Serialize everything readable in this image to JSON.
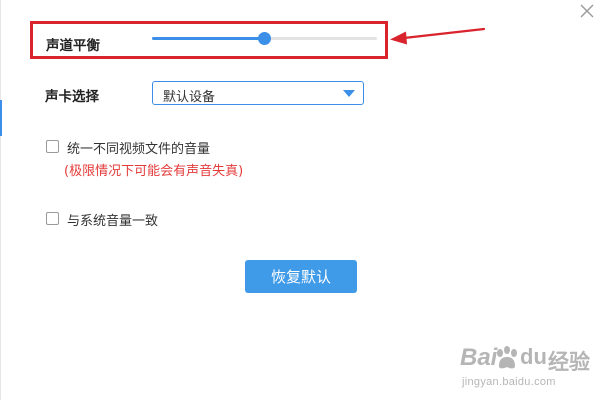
{
  "dialog": {
    "close_icon": "close-icon"
  },
  "balance": {
    "label": "声道平衡",
    "value_percent": 50,
    "highlight_color": "#d9232d",
    "arrow_color": "#d9232d"
  },
  "sound_card": {
    "label": "声卡选择",
    "selected": "默认设备"
  },
  "options": {
    "normalize": {
      "label": "统一不同视频文件的音量",
      "checked": false,
      "warning": "(极限情况下可能会有声音失真)"
    },
    "sync_system": {
      "label": "与系统音量一致",
      "checked": false
    }
  },
  "restore_button": {
    "label": "恢复默认"
  },
  "watermark": {
    "brand_b": "Bai",
    "brand_du": "du",
    "brand_jingyan": "经验",
    "url": "jingyan.baidu.com"
  },
  "colors": {
    "accent": "#3b8fe8",
    "warning": "#e43b3b"
  }
}
